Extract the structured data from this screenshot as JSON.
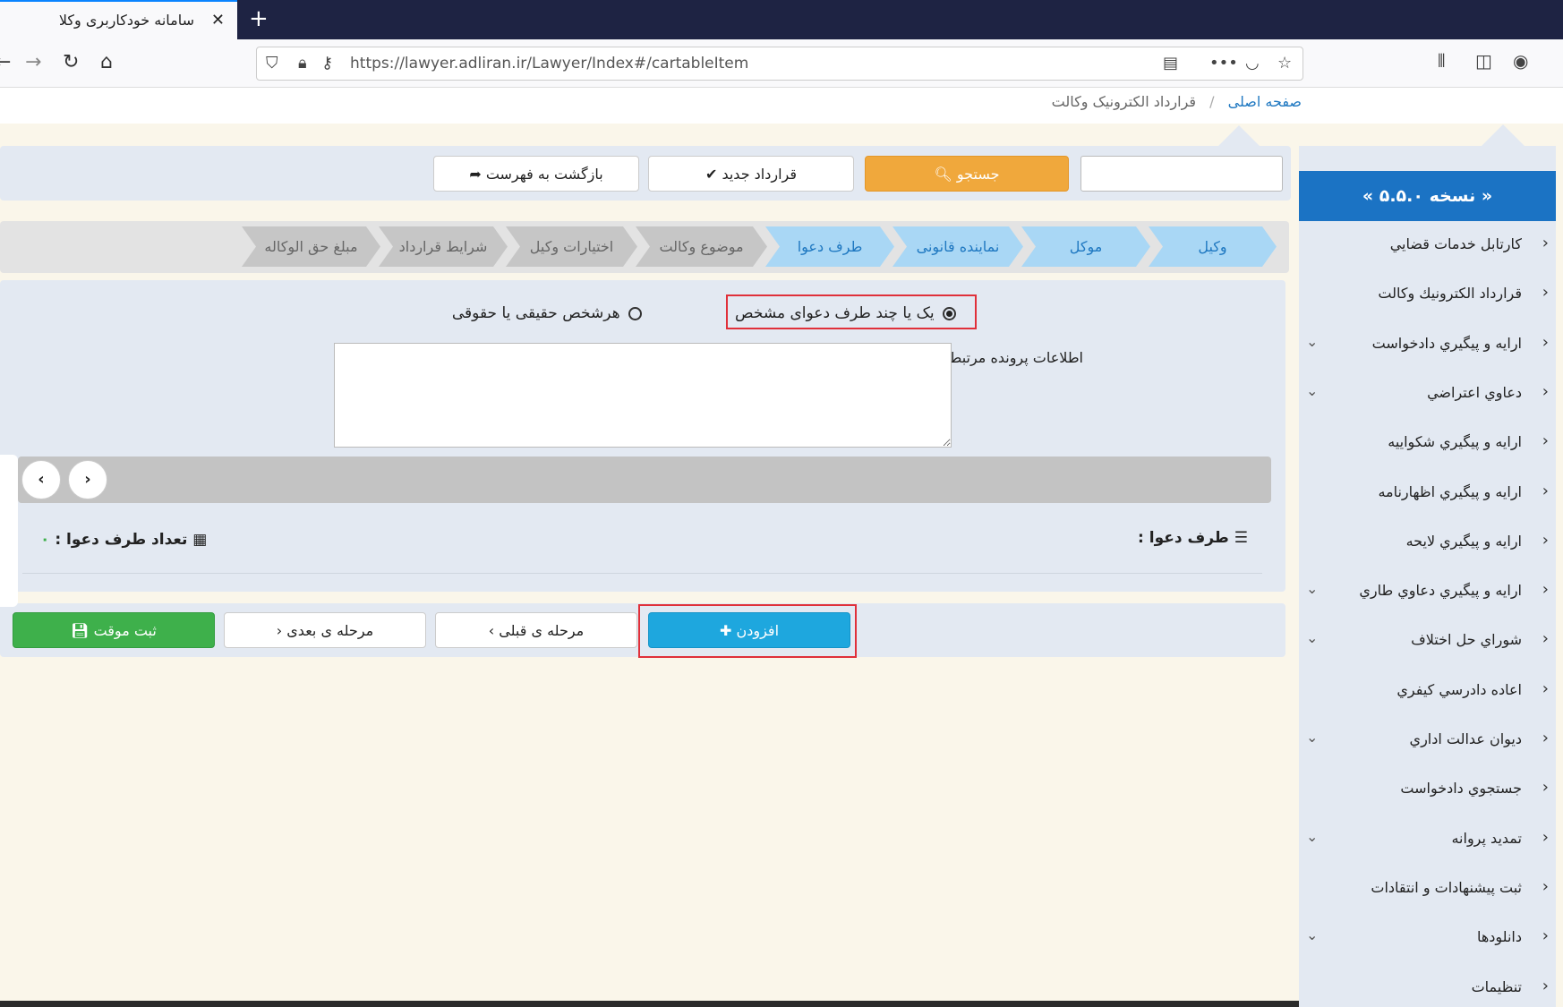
{
  "browser": {
    "tab_title": "سامانه خودکاربری وکلا",
    "url": "https://lawyer.adliran.ir/Lawyer/Index#/cartableItem"
  },
  "breadcrumb": {
    "home": "صفحه اصلی",
    "current": "قرارداد الکترونیک وکالت"
  },
  "toolbar": {
    "search_label": "جستجو",
    "new_contract_label": "قرارداد جدید",
    "back_label": "بازگشت به فهرست"
  },
  "steps": [
    {
      "label": "وکیل",
      "active": true
    },
    {
      "label": "موکل",
      "active": true
    },
    {
      "label": "نماینده قانونی",
      "active": true
    },
    {
      "label": "طرف دعوا",
      "active": true
    },
    {
      "label": "موضوع وکالت",
      "active": false
    },
    {
      "label": "اختیارات وکیل",
      "active": false
    },
    {
      "label": "شرایط قرارداد",
      "active": false
    },
    {
      "label": "مبلغ حق الوکاله",
      "active": false
    }
  ],
  "form": {
    "radio_specific": "یک یا چند طرف دعوای مشخص",
    "radio_any": "هرشخص حقیقی یا حقوقی",
    "related_info_label": "اطلاعات پرونده مرتبط",
    "related_info_value": "",
    "party_label": "طرف دعوا :",
    "count_label": "تعداد طرف دعوا :",
    "count_value": "۰"
  },
  "actions": {
    "add_label": "افزودن",
    "prev_label": "مرحله ی قبلی",
    "next_label": "مرحله ی بعدی",
    "save_label": "ثبت موقت"
  },
  "sidebar": {
    "version": "« نسخه ۵.۵.۰ »",
    "items": [
      {
        "label": "كارتابل خدمات قضايي",
        "expandable": false
      },
      {
        "label": "قرارداد الکترونیك وكالت",
        "expandable": false
      },
      {
        "label": "ارايه و پيگيري دادخواست",
        "expandable": true
      },
      {
        "label": "دعاوي اعتراضي",
        "expandable": true
      },
      {
        "label": "ارايه و پيگيري شكواييه",
        "expandable": false
      },
      {
        "label": "ارايه و پيگيري اظهارنامه",
        "expandable": false
      },
      {
        "label": "ارايه و پيگيري لايحه",
        "expandable": false
      },
      {
        "label": "ارايه و پيگيري دعاوي طاري",
        "expandable": true
      },
      {
        "label": "شوراي حل اختلاف",
        "expandable": true
      },
      {
        "label": "اعاده دادرسي كيفري",
        "expandable": false
      },
      {
        "label": "ديوان عدالت اداري",
        "expandable": true
      },
      {
        "label": "جستجوي دادخواست",
        "expandable": false
      },
      {
        "label": "تمديد پروانه",
        "expandable": true
      },
      {
        "label": "ثبت پیشنهادات و انتقادات",
        "expandable": false
      },
      {
        "label": "دانلودها",
        "expandable": true
      },
      {
        "label": "تنظيمات",
        "expandable": false
      }
    ]
  },
  "colors": {
    "primary": "#1b73c4",
    "step_active": "#a9d7f5",
    "orange": "#f0a83c",
    "blue": "#1ea7de",
    "green": "#3eb04b",
    "highlight": "#e0303a"
  }
}
